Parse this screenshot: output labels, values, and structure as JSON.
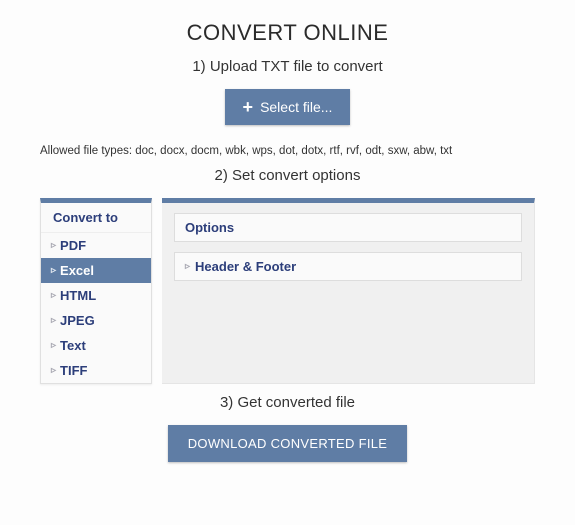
{
  "title": "CONVERT ONLINE",
  "step1": {
    "header": "1) Upload TXT file to convert",
    "select_label": "Select file...",
    "allowed_text": "Allowed file types: doc, docx, docm, wbk, wps, dot, dotx, rtf, rvf, odt, sxw, abw, txt"
  },
  "step2": {
    "header": "2) Set convert options",
    "sidebar_title": "Convert to",
    "formats": [
      "PDF",
      "Excel",
      "HTML",
      "JPEG",
      "Text",
      "TIFF"
    ],
    "active_index": 1,
    "options_label": "Options",
    "header_footer_label": "Header & Footer"
  },
  "step3": {
    "header": "3) Get converted file",
    "download_label": "DOWNLOAD CONVERTED FILE"
  }
}
